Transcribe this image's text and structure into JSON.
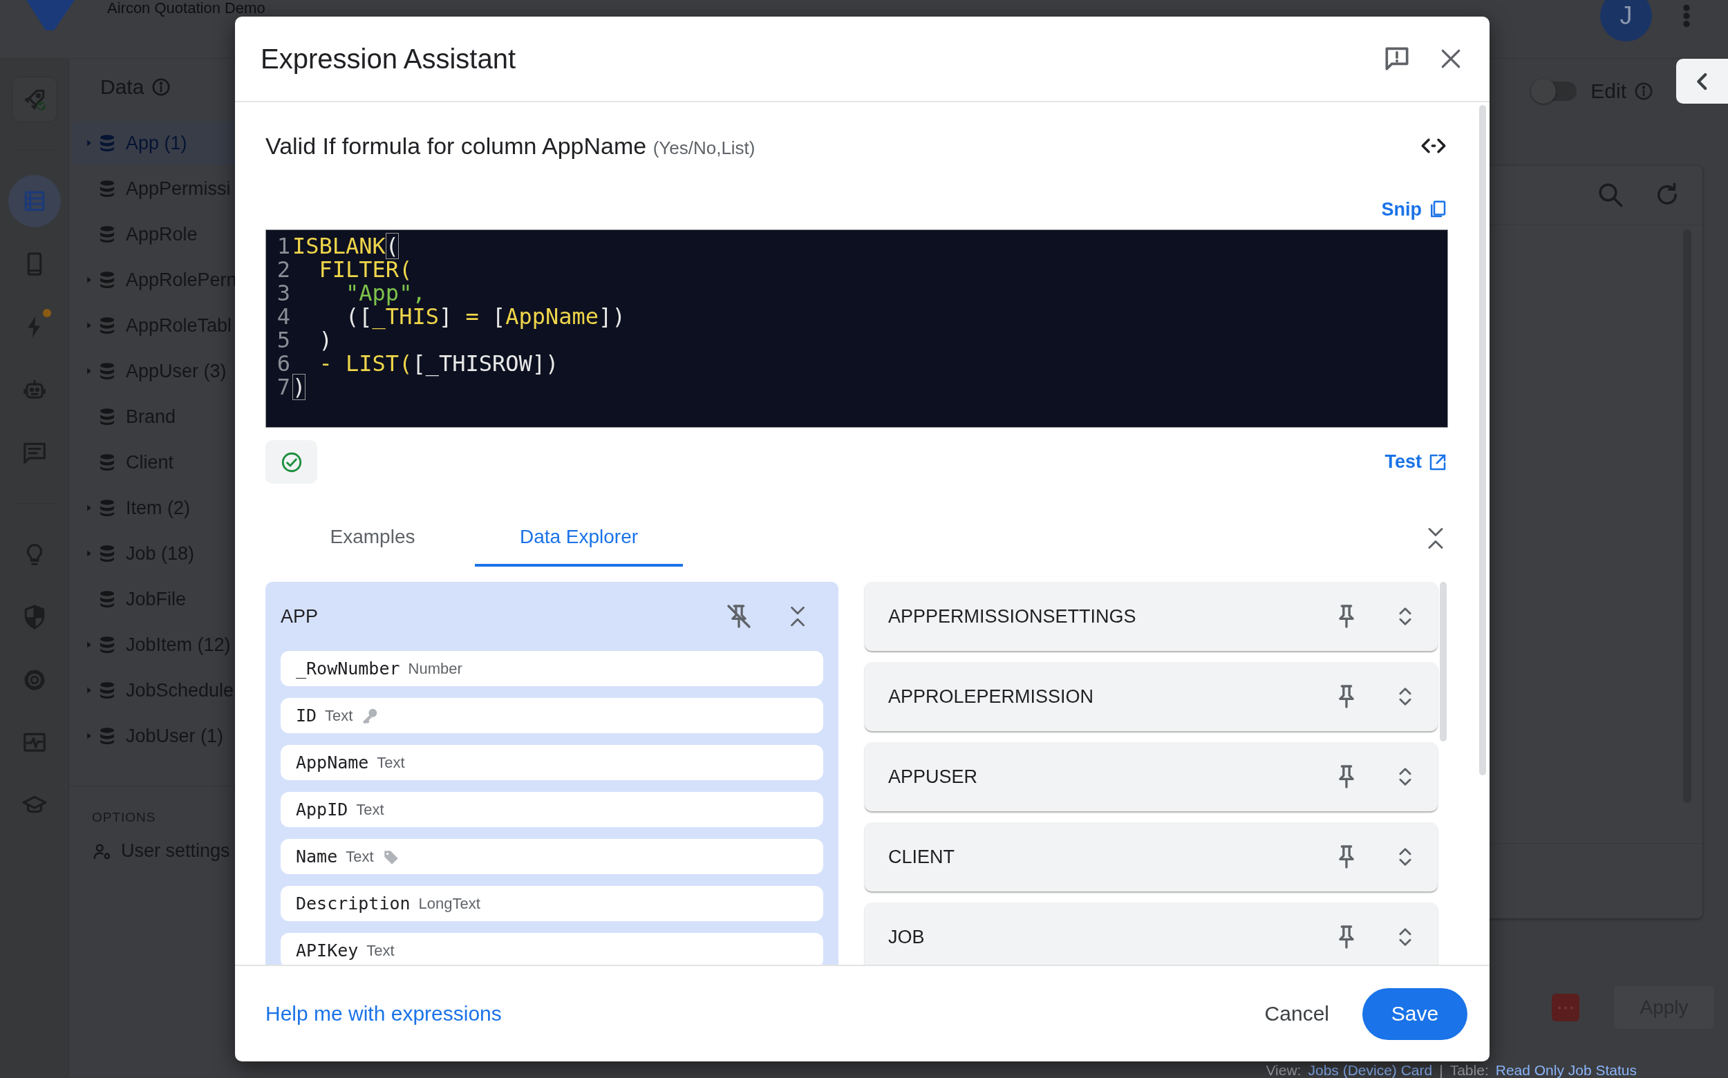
{
  "app_bar": {
    "title": "Aircon Quotation Demo",
    "avatar": "J"
  },
  "nav_groups": [
    [
      {
        "selected": false,
        "badge": false
      }
    ],
    [
      {
        "selected": true,
        "badge": false
      },
      {
        "selected": false,
        "badge": false
      },
      {
        "selected": false,
        "badge": true
      },
      {
        "selected": false,
        "badge": false
      },
      {
        "selected": false,
        "badge": false
      }
    ],
    [
      {
        "selected": false,
        "badge": false
      },
      {
        "selected": false,
        "badge": false
      },
      {
        "selected": false,
        "badge": false
      },
      {
        "selected": false,
        "badge": false
      },
      {
        "selected": false,
        "badge": false
      }
    ]
  ],
  "data_panel": {
    "title": "Data",
    "tables": [
      {
        "label": "App (1)",
        "expandable": true,
        "selected": true
      },
      {
        "label": "AppPermissi",
        "expandable": false,
        "selected": false
      },
      {
        "label": "AppRole",
        "expandable": false,
        "selected": false
      },
      {
        "label": "AppRolePern",
        "expandable": true,
        "selected": false
      },
      {
        "label": "AppRoleTabl",
        "expandable": true,
        "selected": false
      },
      {
        "label": "AppUser (3)",
        "expandable": true,
        "selected": false
      },
      {
        "label": "Brand",
        "expandable": false,
        "selected": false
      },
      {
        "label": "Client",
        "expandable": false,
        "selected": false
      },
      {
        "label": "Item (2)",
        "expandable": true,
        "selected": false
      },
      {
        "label": "Job (18)",
        "expandable": true,
        "selected": false
      },
      {
        "label": "JobFile",
        "expandable": false,
        "selected": false
      },
      {
        "label": "JobItem (12)",
        "expandable": true,
        "selected": false
      },
      {
        "label": "JobSchedule",
        "expandable": true,
        "selected": false
      },
      {
        "label": "JobUser (1)",
        "expandable": true,
        "selected": false
      }
    ],
    "options_heading": "OPTIONS",
    "options": [
      "User settings"
    ]
  },
  "view_panel": {
    "edit_toggle": {
      "label": "Edit",
      "on": false
    },
    "apply_button": "Apply"
  },
  "status_line": {
    "view_label": "View:",
    "view_link": "Jobs (Device) Card",
    "separator": "|",
    "table_label": "Table:",
    "table_link": "Read Only Job Status"
  },
  "dialog": {
    "title": "Expression Assistant",
    "heading": "Valid If formula for column AppName",
    "heading_note": "(Yes/No,List)",
    "snip": "Snip",
    "code_lines": [
      {
        "number": "1",
        "tokens": [
          {
            "text": "ISBLANK",
            "kind": "keyword"
          },
          {
            "text": "(",
            "kind": "match"
          }
        ]
      },
      {
        "number": "2",
        "tokens": [
          {
            "text": "  FILTER(",
            "kind": "keyword"
          }
        ]
      },
      {
        "number": "3",
        "tokens": [
          {
            "text": "    \"App\",",
            "kind": "string"
          }
        ]
      },
      {
        "number": "4",
        "tokens": [
          {
            "text": "    ([",
            "kind": "plain"
          },
          {
            "text": "_THIS",
            "kind": "keyword"
          },
          {
            "text": "] ",
            "kind": "plain"
          },
          {
            "text": "=",
            "kind": "keyword"
          },
          {
            "text": " [",
            "kind": "plain"
          },
          {
            "text": "AppName",
            "kind": "keyword"
          },
          {
            "text": "])",
            "kind": "plain"
          }
        ]
      },
      {
        "number": "5",
        "tokens": [
          {
            "text": "  )",
            "kind": "plain"
          }
        ]
      },
      {
        "number": "6",
        "tokens": [
          {
            "text": "  - LIST(",
            "kind": "keyword"
          },
          {
            "text": "[_THISROW])",
            "kind": "plain"
          }
        ]
      },
      {
        "number": "7",
        "tokens": [
          {
            "text": ")",
            "kind": "match"
          }
        ]
      }
    ],
    "valid": true,
    "test": "Test",
    "tabs": [
      {
        "label": "Examples",
        "selected": false
      },
      {
        "label": "Data Explorer",
        "selected": true
      }
    ],
    "open_table": {
      "name": "APP",
      "pinned": true,
      "expanded": true,
      "fields": [
        {
          "name": "_RowNumber",
          "type": "Number",
          "key": false,
          "label": false
        },
        {
          "name": "ID",
          "type": "Text",
          "key": true,
          "label": false
        },
        {
          "name": "AppName",
          "type": "Text",
          "key": false,
          "label": false
        },
        {
          "name": "AppID",
          "type": "Text",
          "key": false,
          "label": false
        },
        {
          "name": "Name",
          "type": "Text",
          "key": false,
          "label": true
        },
        {
          "name": "Description",
          "type": "LongText",
          "key": false,
          "label": false
        },
        {
          "name": "APIKey",
          "type": "Text",
          "key": false,
          "label": false
        }
      ]
    },
    "other_tables": [
      {
        "name": "APPPERMISSIONSETTINGS",
        "pinned": false,
        "expanded": false
      },
      {
        "name": "APPROLEPERMISSION",
        "pinned": false,
        "expanded": false
      },
      {
        "name": "APPUSER",
        "pinned": false,
        "expanded": false
      },
      {
        "name": "CLIENT",
        "pinned": false,
        "expanded": false
      },
      {
        "name": "JOB",
        "pinned": false,
        "expanded": false
      }
    ],
    "help_link": "Help me with expressions",
    "cancel": "Cancel",
    "save": "Save"
  }
}
